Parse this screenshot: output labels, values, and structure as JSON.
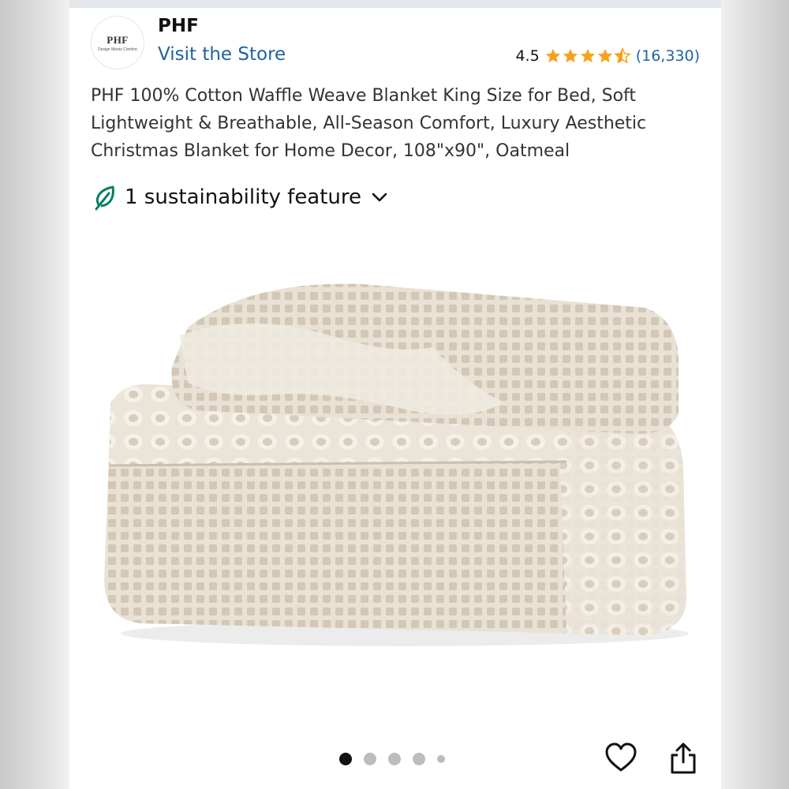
{
  "store": {
    "logo_main": "PHF",
    "logo_tagline": "Design Meets Comfort",
    "brand": "PHF",
    "visit_label": "Visit the Store"
  },
  "rating": {
    "value": "4.5",
    "stars": 4.5,
    "count": "(16,330)",
    "star_color": "#f7a11b"
  },
  "product": {
    "title": "PHF 100% Cotton Waffle Weave Blanket King Size for Bed, Soft Lightweight & Breathable, All-Season Comfort, Luxury Aesthetic Christmas Blanket for Home Decor, 108\"x90\", Oatmeal",
    "sustainability_label": "1 sustainability feature",
    "image_icon": "folded-blanket-image"
  },
  "carousel": {
    "total_dots": 5,
    "active_index": 0
  },
  "actions": {
    "wishlist_icon": "heart-icon",
    "share_icon": "share-icon"
  },
  "colors": {
    "link": "#2162a1",
    "leaf": "#067d62",
    "blanket": "#e6ddd0"
  }
}
